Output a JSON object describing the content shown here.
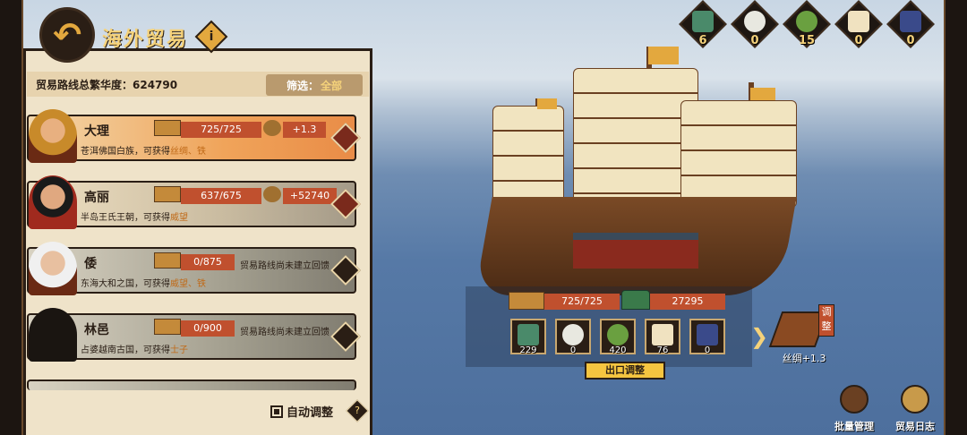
{
  "header": {
    "title": "海外贸易",
    "info_label": "i"
  },
  "summary": {
    "prosperity_label": "贸易路线总繁华度：624790",
    "filter_label": "筛选：",
    "filter_value": "全部"
  },
  "routes": [
    {
      "name": "大理",
      "desc": "苍洱佛国白族，可获得",
      "desc_goods": "丝绸、铁",
      "capacity": "725/725",
      "bonus": "+1.3",
      "status": ""
    },
    {
      "name": "高丽",
      "desc": "半岛王氏王朝，可获得",
      "desc_goods": "威望",
      "capacity": "637/675",
      "bonus": "+52740",
      "status": ""
    },
    {
      "name": "倭",
      "desc": "东海大和之国，可获得",
      "desc_goods": "威望、铁",
      "capacity": "0/875",
      "bonus": "",
      "status": "贸易路线尚未建立回馈"
    },
    {
      "name": "林邑",
      "desc": "占婆越南古国，可获得",
      "desc_goods": "士子",
      "capacity": "0/900",
      "bonus": "",
      "status": "贸易路线尚未建立回馈"
    }
  ],
  "auto_adjust_label": "自动调整",
  "help_label": "?",
  "resources": [
    {
      "icon": "bronze-vessel-icon",
      "value": "6"
    },
    {
      "icon": "porcelain-plate-icon",
      "value": "0"
    },
    {
      "icon": "tea-leaves-icon",
      "value": "15"
    },
    {
      "icon": "scroll-painting-icon",
      "value": "0"
    },
    {
      "icon": "book-icon",
      "value": "0"
    }
  ],
  "ship": {
    "capacity": "725/725",
    "money": "27295"
  },
  "cargo_slots": [
    {
      "icon": "bronze-vessel-icon",
      "value": "229"
    },
    {
      "icon": "porcelain-plate-icon",
      "value": "0"
    },
    {
      "icon": "tea-leaves-icon",
      "value": "420"
    },
    {
      "icon": "scroll-painting-icon",
      "value": "76"
    },
    {
      "icon": "book-icon",
      "value": "0"
    }
  ],
  "export_label": "出口调整",
  "silk": {
    "adjust_tag": "调整",
    "label": "丝绸+1.3"
  },
  "bottom": {
    "batch_label": "批量管理",
    "log_label": "贸易日志"
  },
  "colors": {
    "accent": "#f5d27a",
    "red_bar": "#c0502e",
    "frame": "#2a1e15"
  }
}
